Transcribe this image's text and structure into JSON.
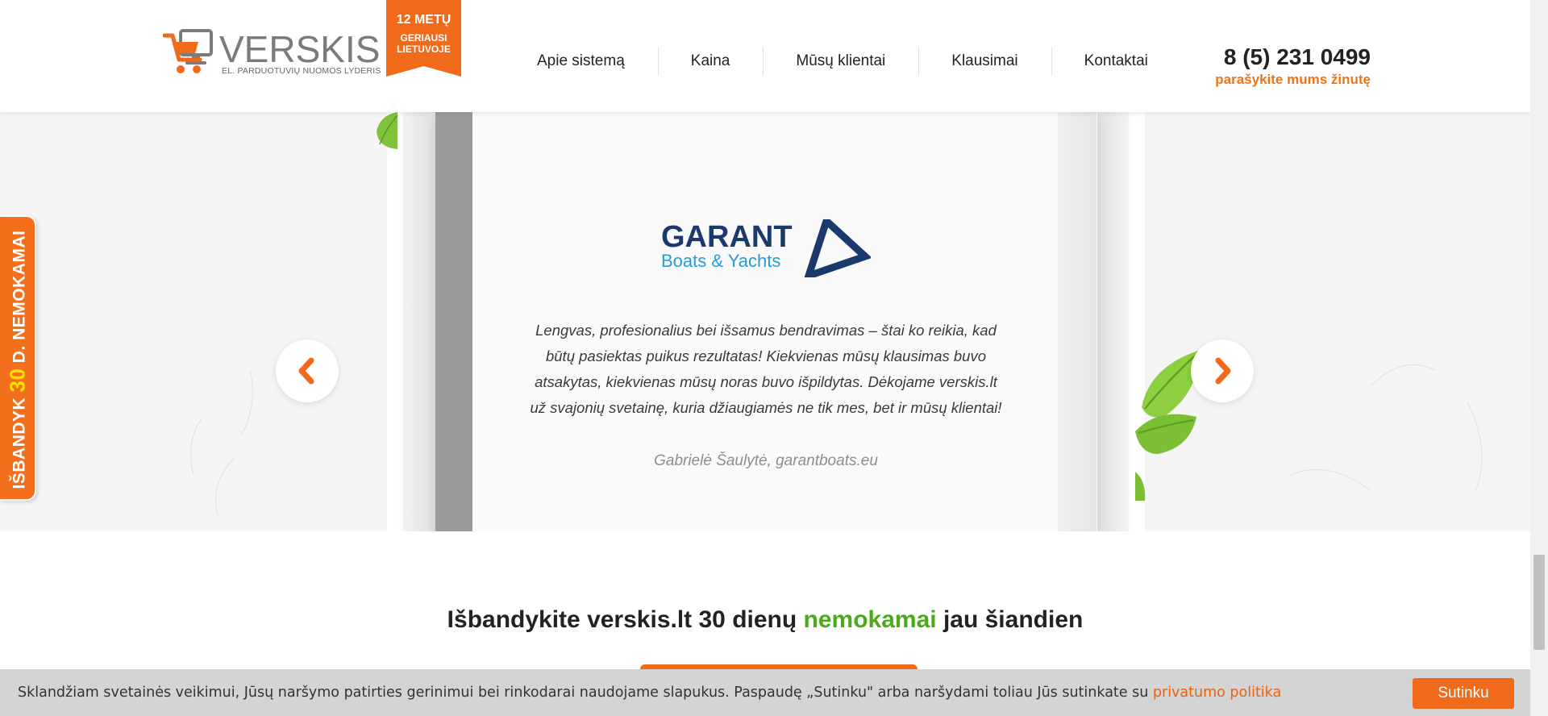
{
  "header": {
    "logo_text": "VERSKIS",
    "logo_tagline": "EL. PARDUOTUVIŲ NUOMOS LYDERIS",
    "badge_line1": "12 METŲ",
    "badge_line2": "GERIAUSI",
    "badge_line3": "LIETUVOJE",
    "nav": [
      {
        "label": "Apie sistemą"
      },
      {
        "label": "Kaina"
      },
      {
        "label": "Mūsų klientai"
      },
      {
        "label": "Klausimai"
      },
      {
        "label": "Kontaktai"
      }
    ],
    "phone": "8 (5) 231 0499",
    "phone_sub": "parašykite mums žinutę"
  },
  "side_tab": {
    "prefix": "IŠBANDYK ",
    "highlight": "30",
    "suffix": " D. NEMOKAMAI"
  },
  "testimonial": {
    "client_logo_title": "GARANT",
    "client_logo_sub": "Boats & Yachts",
    "quote": "Lengvas, profesionalius bei išsamus bendravimas – štai ko reikia, kad būtų pasiektas puikus rezultatas! Kiekvienas mūsų klausimas buvo atsakytas, kiekvienas mūsų noras buvo išpildytas. Dėkojame verskis.lt už svajonių svetainę, kuria džiaugiamės ne tik mes, bet ir mūsų klientai!",
    "author": "Gabrielė Šaulytė, garantboats.eu",
    "prev_icon": "chevron-left-icon",
    "next_icon": "chevron-right-icon"
  },
  "cta": {
    "title_before": "Išbandykite verskis.lt 30 dienų ",
    "title_highlight": "nemokamai",
    "title_after": " jau šiandien"
  },
  "cookie": {
    "text": "Sklandžiam svetainės veikimui, Jūsų naršymo patirties gerinimui bei rinkodarai naudojame slapukus. Paspaudę „Sutinku\" arba naršydami toliau Jūs sutinkate su ",
    "link": "privatumo politika",
    "button": "Sutinku"
  },
  "colors": {
    "accent": "#f06a1a",
    "green": "#4caa1a",
    "garant_blue": "#1b3a6b",
    "garant_light": "#2a9ad6"
  }
}
